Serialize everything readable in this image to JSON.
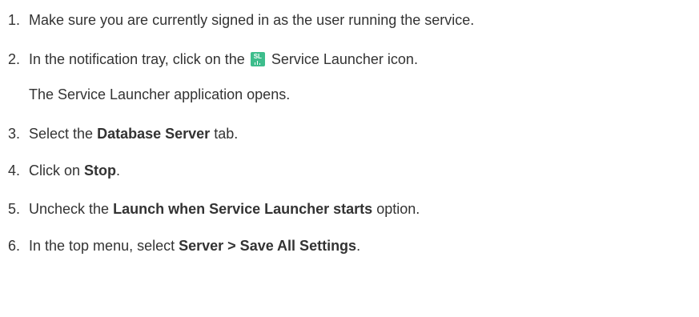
{
  "steps": [
    {
      "number": "1.",
      "text": "Make sure you are currently signed in as the user running the service."
    },
    {
      "number": "2.",
      "before": "In the notification tray, click on the",
      "icon": {
        "name": "service-launcher-icon",
        "label": "SL",
        "color": "#3dbd8c"
      },
      "after": "Service Launcher icon.",
      "result": "The Service Launcher application opens."
    },
    {
      "number": "3.",
      "before": "Select the",
      "bold": "Database Server",
      "after": "tab."
    },
    {
      "number": "4.",
      "before": "Click on",
      "bold": "Stop",
      "after": "."
    },
    {
      "number": "5.",
      "before": "Uncheck the",
      "bold": "Launch when Service Launcher starts",
      "after": "option."
    },
    {
      "number": "6.",
      "before": "In the top menu, select",
      "bold": "Server > Save All Settings",
      "after": "."
    }
  ],
  "colors": {
    "text": "#333333",
    "icon_bg": "#3dbd8c"
  }
}
